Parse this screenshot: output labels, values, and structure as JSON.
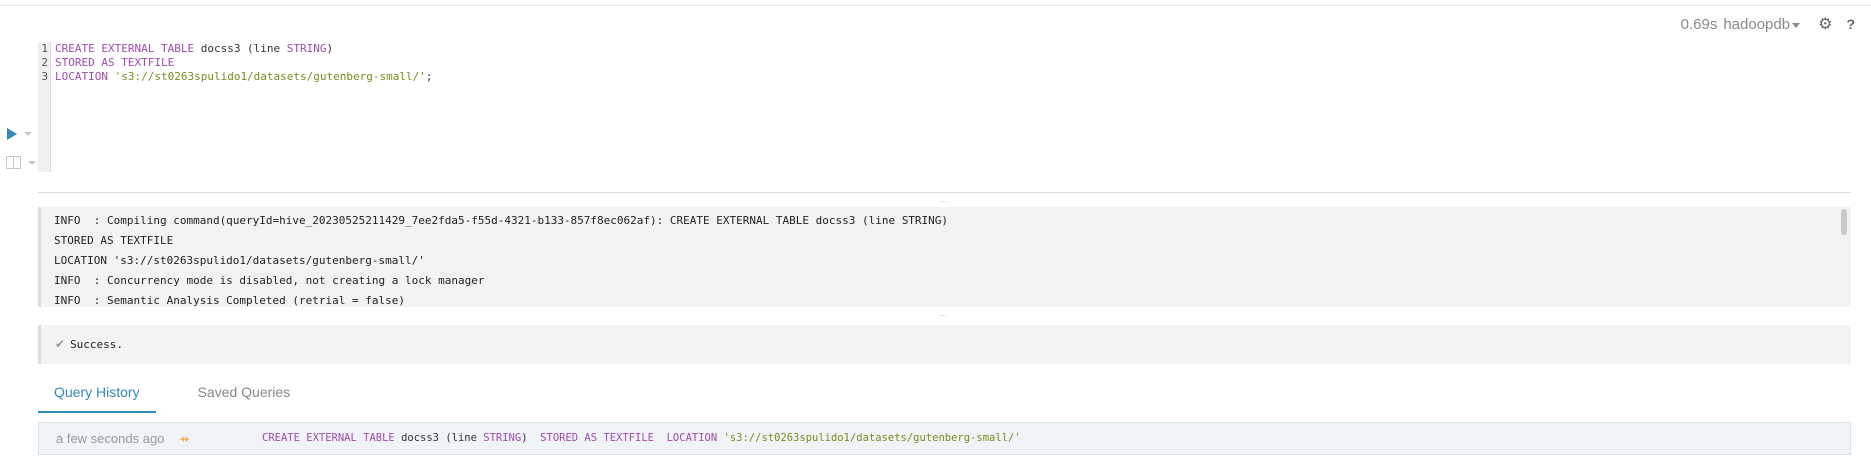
{
  "header": {
    "exec_time": "0.69s",
    "database": "hadoopdb"
  },
  "editor": {
    "line_numbers": [
      "1",
      "2",
      "3"
    ],
    "lines": [
      [
        {
          "text": "CREATE EXTERNAL TABLE ",
          "kind": "kw"
        },
        {
          "text": "docss3 (line ",
          "kind": "plain"
        },
        {
          "text": "STRING",
          "kind": "kw"
        },
        {
          "text": ")",
          "kind": "plain"
        }
      ],
      [
        {
          "text": "STORED AS TEXTFILE",
          "kind": "kw"
        }
      ],
      [
        {
          "text": "LOCATION ",
          "kind": "kw"
        },
        {
          "text": "'s3://st0263spulido1/datasets/gutenberg-small/'",
          "kind": "str"
        },
        {
          "text": ";",
          "kind": "plain"
        }
      ]
    ]
  },
  "log": {
    "lines": [
      "INFO  : Compiling command(queryId=hive_20230525211429_7ee2fda5-f55d-4321-b133-857f8ec062af): CREATE EXTERNAL TABLE docss3 (line STRING)",
      "STORED AS TEXTFILE",
      "LOCATION 's3://st0263spulido1/datasets/gutenberg-small/'",
      "INFO  : Concurrency mode is disabled, not creating a lock manager",
      "INFO  : Semantic Analysis Completed (retrial = false)"
    ]
  },
  "result": {
    "status_text": "Success."
  },
  "tabs": [
    {
      "label": "Query History",
      "active": true
    },
    {
      "label": "Saved Queries",
      "active": false
    }
  ],
  "history": {
    "time": "a few seconds ago",
    "sql": [
      {
        "text": "CREATE EXTERNAL TABLE ",
        "kind": "kw"
      },
      {
        "text": "docss3 (line ",
        "kind": "plain"
      },
      {
        "text": "STRING",
        "kind": "kw"
      },
      {
        "text": ")  ",
        "kind": "plain"
      },
      {
        "text": "STORED AS TEXTFILE  ",
        "kind": "kw"
      },
      {
        "text": "LOCATION ",
        "kind": "kw"
      },
      {
        "text": "'s3://st0263spulido1/datasets/gutenberg-small/'",
        "kind": "str"
      }
    ]
  },
  "colors": {
    "accent": "#338bb8",
    "keyword": "#a14aae",
    "string": "#7a8b1f",
    "history_icon": "#f0a02c"
  },
  "icons": {
    "run": "play-icon",
    "settings": "gear-icon",
    "help": "help-icon",
    "book": "book-icon",
    "success": "check-icon",
    "history_status": "arrow-icon"
  }
}
